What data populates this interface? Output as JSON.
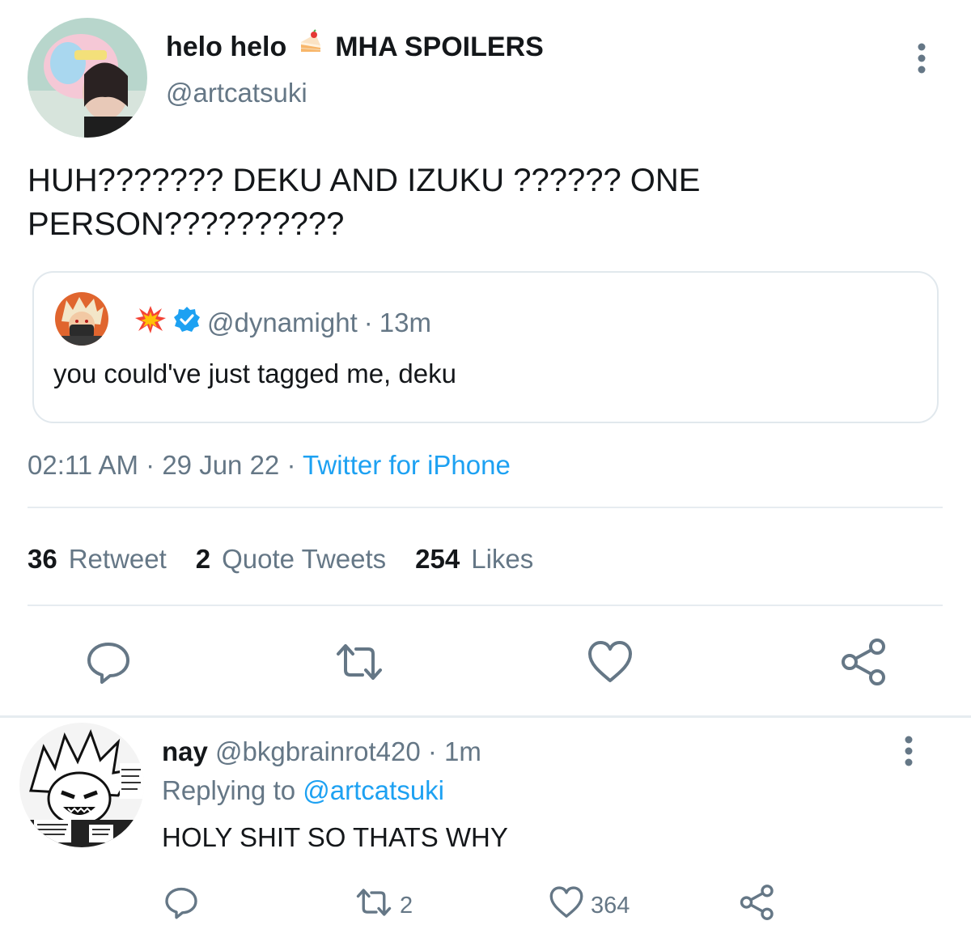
{
  "tweet": {
    "display_name": "helo helo",
    "name_emoji": "cake-emoji",
    "name_suffix": "MHA SPOILERS",
    "handle": "@artcatsuki",
    "text_line1": "HUH??????? DEKU AND IZUKU ?????? ONE",
    "text_line2": "PERSON??????????",
    "quote": {
      "name_emoji": "collision-emoji",
      "verified_icon": "verified-badge-icon",
      "handle": "@dynamight",
      "separator": "·",
      "time": "13m",
      "text": "you could've just tagged me, deku"
    },
    "time": "02:11 AM",
    "separator": "·",
    "date": "29 Jun 22",
    "source": "Twitter for iPhone",
    "stats": [
      {
        "count": "36",
        "label": "Retweet"
      },
      {
        "count": "2",
        "label": "Quote Tweets"
      },
      {
        "count": "254",
        "label": "Likes"
      }
    ],
    "actions": [
      "reply-icon",
      "retweet-icon",
      "like-icon",
      "share-icon"
    ]
  },
  "reply": {
    "name": "nay",
    "handle": "@bkgbrainrot420",
    "separator": "·",
    "time": "1m",
    "replying_to_label": "Replying to",
    "replying_to_handle": "@artcatsuki",
    "text": "HOLY SHIT SO THATS WHY",
    "retweets": "2",
    "likes": "364"
  },
  "colors": {
    "text": "#14171a",
    "secondary": "#657786",
    "link": "#1da1f2",
    "border": "#e1e8ed"
  }
}
